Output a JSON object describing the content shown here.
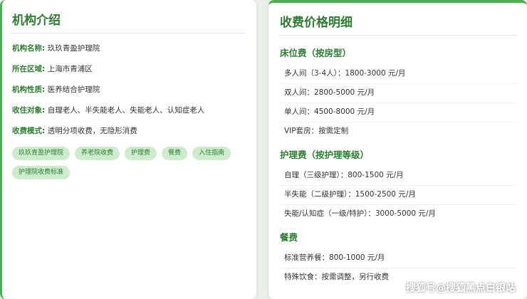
{
  "left": {
    "title": "机构介绍",
    "rows": [
      {
        "label": "机构名称:",
        "value": "玖玖青盈护理院"
      },
      {
        "label": "所在区域:",
        "value": "上海市青浦区"
      },
      {
        "label": "机构性质:",
        "value": "医养结合护理院"
      },
      {
        "label": "收住对象:",
        "value": "自理老人、半失能老人、失能老人、认知症老人"
      },
      {
        "label": "收费模式:",
        "value": "透明分项收费，无隐形消费"
      }
    ],
    "tags": [
      "玖玖青盈护理院",
      "养老院收费",
      "护理费",
      "餐费",
      "入住指南",
      "护理院收费标准"
    ]
  },
  "right": {
    "title": "收费价格明细",
    "sections": [
      {
        "title": "床位费（按房型）",
        "items": [
          "多人间（3-4人）：1800-3000 元/月",
          "双人间：2800-5000 元/月",
          "单人间：4500-8000 元/月",
          "VIP套房：按需定制"
        ]
      },
      {
        "title": "护理费（按护理等级）",
        "items": [
          "自理（三级护理）：800-1500 元/月",
          "半失能（二级护理）：1500-2500 元/月",
          "失能/认知症（一级/特护）：3000-5000 元/月"
        ]
      },
      {
        "title": "餐费",
        "items": [
          "标准营养餐：800-1000 元/月",
          "特殊饮食：按需调整，另行收费"
        ]
      }
    ]
  },
  "watermark": "搜狐号@搜狐黑点白银站",
  "colors": {
    "accent": "#2e7d32",
    "border": "#4caf50",
    "tag_bg": "#cdeccd"
  }
}
